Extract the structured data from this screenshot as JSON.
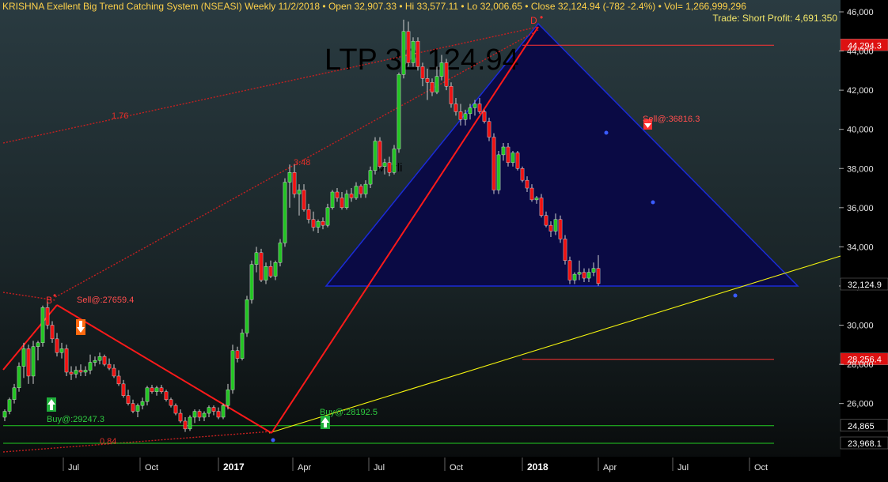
{
  "header": {
    "title": "KRISHNA Exellent Big Trend Catching System (NSEASI) Weekly  11/2/2018  • Open 32,907.33  • Hi 33,577.11  • Lo 32,006.65  • Close 32,124.94 (-782 -2.4%)  • Vol= 1,266,999,296",
    "trade": "Trade: Short Profit: 4,691.350"
  },
  "ltp_label": "LTP 32,124.94",
  "annotation_murli": "Murli",
  "colors": {
    "background_top": "#2a3a40",
    "background_bottom": "#0b0f10",
    "triangle_fill": "#0a0a44",
    "triangle_edge": "#1a2bd8",
    "bull": "#22c422",
    "bear": "#ee1111",
    "trend": "#ff1a1a",
    "support": "#f4f40e",
    "green_level": "#22cc22"
  },
  "chart_data": {
    "type": "candlestick",
    "title": "KRISHNA Exellent Big Trend Catching System (NSEASI) Weekly",
    "y_ticks": [
      26000,
      28000,
      30000,
      32000,
      34000,
      36000,
      38000,
      40000,
      42000,
      44000,
      46000
    ],
    "y_tick_labels": [
      "26,000",
      "28,000",
      "30,000",
      "32,000",
      "34,000",
      "36,000",
      "38,000",
      "40,000",
      "42,000",
      "44,000",
      "46,000"
    ],
    "ylim": [
      23350,
      46500
    ],
    "x_tick_labels": [
      "Jul",
      "Oct",
      "2017",
      "Apr",
      "Jul",
      "Oct",
      "2018",
      "Apr",
      "Jul",
      "Oct"
    ],
    "current_price": {
      "value": 32124.94,
      "label": "32,124.9"
    },
    "levels": [
      {
        "value": 44294.3,
        "label": "44,294.3",
        "color": "#ff3333",
        "box": "red"
      },
      {
        "value": 28256.4,
        "label": "28,256.4",
        "color": "#ff3333",
        "box": "red"
      },
      {
        "value": 24865,
        "label": "24,865",
        "color": "#22cc22",
        "box": "black"
      },
      {
        "value": 23968.1,
        "label": "23,968.1",
        "color": "#22cc22",
        "box": "black"
      }
    ],
    "signals": [
      {
        "type": "sell",
        "label": "Sell@:27659.4"
      },
      {
        "type": "buy",
        "label": "Buy@:29247.3"
      },
      {
        "type": "buy",
        "label": "Buy@:28192.5"
      },
      {
        "type": "sell",
        "label": "Sell@:36816.3"
      }
    ],
    "pattern_points": [
      {
        "label": "B",
        "value": 31150
      },
      {
        "label": "D",
        "value": 45400
      }
    ],
    "fib_labels": [
      "1.76",
      "3.48",
      "0.84"
    ],
    "ohlc": [
      {
        "o": 25300,
        "h": 25700,
        "l": 25100,
        "c": 25600
      },
      {
        "o": 25600,
        "h": 26300,
        "l": 25450,
        "c": 26200
      },
      {
        "o": 26200,
        "h": 27000,
        "l": 26000,
        "c": 26800
      },
      {
        "o": 26800,
        "h": 28100,
        "l": 26600,
        "c": 27900
      },
      {
        "o": 27900,
        "h": 29100,
        "l": 27300,
        "c": 28800
      },
      {
        "o": 28800,
        "h": 29000,
        "l": 27000,
        "c": 27400
      },
      {
        "o": 27400,
        "h": 29200,
        "l": 27000,
        "c": 28900
      },
      {
        "o": 28900,
        "h": 29200,
        "l": 28200,
        "c": 29100
      },
      {
        "o": 29100,
        "h": 31000,
        "l": 28900,
        "c": 30900
      },
      {
        "o": 30900,
        "h": 31200,
        "l": 29800,
        "c": 30000
      },
      {
        "o": 30000,
        "h": 30200,
        "l": 29100,
        "c": 29300
      },
      {
        "o": 29300,
        "h": 29600,
        "l": 28400,
        "c": 28600
      },
      {
        "o": 28600,
        "h": 29100,
        "l": 28300,
        "c": 28800
      },
      {
        "o": 28800,
        "h": 29000,
        "l": 27400,
        "c": 27600
      },
      {
        "o": 27600,
        "h": 27900,
        "l": 27200,
        "c": 27500
      },
      {
        "o": 27500,
        "h": 27900,
        "l": 27300,
        "c": 27700
      },
      {
        "o": 27700,
        "h": 28000,
        "l": 27400,
        "c": 27600
      },
      {
        "o": 27600,
        "h": 27900,
        "l": 27400,
        "c": 27700
      },
      {
        "o": 27700,
        "h": 28500,
        "l": 27500,
        "c": 28100
      },
      {
        "o": 28100,
        "h": 28400,
        "l": 27900,
        "c": 28200
      },
      {
        "o": 28200,
        "h": 28600,
        "l": 28000,
        "c": 28400
      },
      {
        "o": 28400,
        "h": 28500,
        "l": 27900,
        "c": 28000
      },
      {
        "o": 28000,
        "h": 28300,
        "l": 27700,
        "c": 27800
      },
      {
        "o": 27800,
        "h": 28000,
        "l": 27300,
        "c": 27400
      },
      {
        "o": 27400,
        "h": 27700,
        "l": 26900,
        "c": 27000
      },
      {
        "o": 27000,
        "h": 27200,
        "l": 26300,
        "c": 26400
      },
      {
        "o": 26400,
        "h": 26700,
        "l": 25900,
        "c": 26000
      },
      {
        "o": 26000,
        "h": 26200,
        "l": 25500,
        "c": 25600
      },
      {
        "o": 25600,
        "h": 26000,
        "l": 25300,
        "c": 25900
      },
      {
        "o": 25900,
        "h": 26300,
        "l": 25700,
        "c": 26100
      },
      {
        "o": 26100,
        "h": 26900,
        "l": 25900,
        "c": 26800
      },
      {
        "o": 26800,
        "h": 26950,
        "l": 26500,
        "c": 26600
      },
      {
        "o": 26600,
        "h": 26900,
        "l": 26400,
        "c": 26800
      },
      {
        "o": 26800,
        "h": 26950,
        "l": 26500,
        "c": 26600
      },
      {
        "o": 26600,
        "h": 26700,
        "l": 26100,
        "c": 26200
      },
      {
        "o": 26200,
        "h": 26300,
        "l": 25800,
        "c": 25900
      },
      {
        "o": 25900,
        "h": 26000,
        "l": 25400,
        "c": 25500
      },
      {
        "o": 25500,
        "h": 25700,
        "l": 25000,
        "c": 25100
      },
      {
        "o": 25100,
        "h": 25300,
        "l": 24550,
        "c": 24700
      },
      {
        "o": 24700,
        "h": 25400,
        "l": 24600,
        "c": 25300
      },
      {
        "o": 25300,
        "h": 25700,
        "l": 25000,
        "c": 25600
      },
      {
        "o": 25600,
        "h": 25700,
        "l": 25100,
        "c": 25300
      },
      {
        "o": 25300,
        "h": 25600,
        "l": 25100,
        "c": 25500
      },
      {
        "o": 25500,
        "h": 25900,
        "l": 25300,
        "c": 25800
      },
      {
        "o": 25800,
        "h": 25900,
        "l": 25400,
        "c": 25600
      },
      {
        "o": 25600,
        "h": 25800,
        "l": 25200,
        "c": 25300
      },
      {
        "o": 25300,
        "h": 26000,
        "l": 25200,
        "c": 25900
      },
      {
        "o": 25900,
        "h": 27000,
        "l": 25700,
        "c": 26700
      },
      {
        "o": 26700,
        "h": 29000,
        "l": 26500,
        "c": 28700
      },
      {
        "o": 28700,
        "h": 28900,
        "l": 28100,
        "c": 28300
      },
      {
        "o": 28300,
        "h": 29800,
        "l": 28200,
        "c": 29600
      },
      {
        "o": 29600,
        "h": 31500,
        "l": 29400,
        "c": 31300
      },
      {
        "o": 31300,
        "h": 33300,
        "l": 31100,
        "c": 33100
      },
      {
        "o": 33100,
        "h": 34000,
        "l": 32700,
        "c": 33700
      },
      {
        "o": 33700,
        "h": 33900,
        "l": 32200,
        "c": 32300
      },
      {
        "o": 32300,
        "h": 33200,
        "l": 32100,
        "c": 33000
      },
      {
        "o": 33000,
        "h": 33300,
        "l": 32400,
        "c": 32500
      },
      {
        "o": 32500,
        "h": 33300,
        "l": 32300,
        "c": 33200
      },
      {
        "o": 33200,
        "h": 34400,
        "l": 33000,
        "c": 34200
      },
      {
        "o": 34200,
        "h": 37500,
        "l": 34000,
        "c": 37300
      },
      {
        "o": 37300,
        "h": 38200,
        "l": 36000,
        "c": 37800
      },
      {
        "o": 37800,
        "h": 38200,
        "l": 36500,
        "c": 36700
      },
      {
        "o": 36700,
        "h": 37200,
        "l": 35600,
        "c": 36900
      },
      {
        "o": 36900,
        "h": 37200,
        "l": 35800,
        "c": 35900
      },
      {
        "o": 35900,
        "h": 36200,
        "l": 35200,
        "c": 35400
      },
      {
        "o": 35400,
        "h": 35800,
        "l": 34800,
        "c": 35000
      },
      {
        "o": 35000,
        "h": 35400,
        "l": 34700,
        "c": 35300
      },
      {
        "o": 35300,
        "h": 35500,
        "l": 34900,
        "c": 35100
      },
      {
        "o": 35100,
        "h": 36200,
        "l": 35000,
        "c": 36000
      },
      {
        "o": 36000,
        "h": 36900,
        "l": 35900,
        "c": 36800
      },
      {
        "o": 36800,
        "h": 37000,
        "l": 36300,
        "c": 36500
      },
      {
        "o": 36500,
        "h": 36800,
        "l": 35900,
        "c": 36000
      },
      {
        "o": 36000,
        "h": 36900,
        "l": 35900,
        "c": 36700
      },
      {
        "o": 36700,
        "h": 37000,
        "l": 36300,
        "c": 36500
      },
      {
        "o": 36500,
        "h": 37300,
        "l": 36400,
        "c": 37100
      },
      {
        "o": 37100,
        "h": 37200,
        "l": 36500,
        "c": 36700
      },
      {
        "o": 36700,
        "h": 37400,
        "l": 36500,
        "c": 37200
      },
      {
        "o": 37200,
        "h": 38100,
        "l": 37000,
        "c": 37900
      },
      {
        "o": 37900,
        "h": 39600,
        "l": 37700,
        "c": 39400
      },
      {
        "o": 39400,
        "h": 39600,
        "l": 38000,
        "c": 38100
      },
      {
        "o": 38100,
        "h": 38500,
        "l": 37700,
        "c": 38300
      },
      {
        "o": 38300,
        "h": 38600,
        "l": 37600,
        "c": 37800
      },
      {
        "o": 37800,
        "h": 39200,
        "l": 37700,
        "c": 39000
      },
      {
        "o": 39000,
        "h": 42900,
        "l": 38800,
        "c": 42800
      },
      {
        "o": 42800,
        "h": 45600,
        "l": 42600,
        "c": 45000
      },
      {
        "o": 45000,
        "h": 45500,
        "l": 43200,
        "c": 43400
      },
      {
        "o": 43400,
        "h": 44700,
        "l": 43200,
        "c": 44500
      },
      {
        "o": 44500,
        "h": 44700,
        "l": 43000,
        "c": 43200
      },
      {
        "o": 43200,
        "h": 43400,
        "l": 42200,
        "c": 42600
      },
      {
        "o": 42600,
        "h": 43100,
        "l": 41500,
        "c": 42400
      },
      {
        "o": 42400,
        "h": 42600,
        "l": 41700,
        "c": 41900
      },
      {
        "o": 41900,
        "h": 43200,
        "l": 41800,
        "c": 42700
      },
      {
        "o": 42700,
        "h": 43800,
        "l": 42500,
        "c": 43400
      },
      {
        "o": 43400,
        "h": 43600,
        "l": 42000,
        "c": 42200
      },
      {
        "o": 42200,
        "h": 42400,
        "l": 41100,
        "c": 41300
      },
      {
        "o": 41300,
        "h": 41600,
        "l": 40700,
        "c": 40900
      },
      {
        "o": 40900,
        "h": 41300,
        "l": 40200,
        "c": 40500
      },
      {
        "o": 40500,
        "h": 41000,
        "l": 40200,
        "c": 40800
      },
      {
        "o": 40800,
        "h": 41300,
        "l": 40500,
        "c": 41100
      },
      {
        "o": 41100,
        "h": 41500,
        "l": 40700,
        "c": 41300
      },
      {
        "o": 41300,
        "h": 41600,
        "l": 40800,
        "c": 40900
      },
      {
        "o": 40900,
        "h": 41000,
        "l": 40300,
        "c": 40400
      },
      {
        "o": 40400,
        "h": 40600,
        "l": 39400,
        "c": 39600
      },
      {
        "o": 39600,
        "h": 39800,
        "l": 36700,
        "c": 36900
      },
      {
        "o": 36900,
        "h": 38900,
        "l": 36700,
        "c": 38700
      },
      {
        "o": 38700,
        "h": 39300,
        "l": 38400,
        "c": 39100
      },
      {
        "o": 39100,
        "h": 39300,
        "l": 38100,
        "c": 38300
      },
      {
        "o": 38300,
        "h": 38900,
        "l": 38100,
        "c": 38800
      },
      {
        "o": 38800,
        "h": 38900,
        "l": 37900,
        "c": 38000
      },
      {
        "o": 38000,
        "h": 38100,
        "l": 37300,
        "c": 37400
      },
      {
        "o": 37400,
        "h": 37600,
        "l": 36800,
        "c": 37000
      },
      {
        "o": 37000,
        "h": 37200,
        "l": 36300,
        "c": 36400
      },
      {
        "o": 36400,
        "h": 36600,
        "l": 36200,
        "c": 36500
      },
      {
        "o": 36500,
        "h": 36700,
        "l": 35500,
        "c": 35600
      },
      {
        "o": 35600,
        "h": 35800,
        "l": 35000,
        "c": 35100
      },
      {
        "o": 35100,
        "h": 35300,
        "l": 34500,
        "c": 34800
      },
      {
        "o": 34800,
        "h": 35700,
        "l": 34600,
        "c": 35400
      },
      {
        "o": 35400,
        "h": 35600,
        "l": 34200,
        "c": 34400
      },
      {
        "o": 34400,
        "h": 34600,
        "l": 33100,
        "c": 33300
      },
      {
        "o": 33300,
        "h": 33500,
        "l": 32100,
        "c": 32300
      },
      {
        "o": 32300,
        "h": 32700,
        "l": 32100,
        "c": 32600
      },
      {
        "o": 32600,
        "h": 33300,
        "l": 32300,
        "c": 32700
      },
      {
        "o": 32700,
        "h": 32900,
        "l": 32200,
        "c": 32400
      },
      {
        "o": 32400,
        "h": 32900,
        "l": 32200,
        "c": 32700
      },
      {
        "o": 32700,
        "h": 33200,
        "l": 32500,
        "c": 32900
      },
      {
        "o": 32900,
        "h": 33577,
        "l": 32007,
        "c": 32125
      }
    ]
  }
}
